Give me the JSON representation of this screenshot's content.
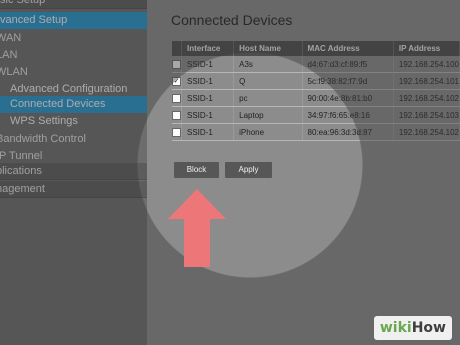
{
  "sidebar": {
    "items": [
      {
        "label": "sic Setup",
        "style": "sec"
      },
      {
        "label": "vanced Setup",
        "style": "active"
      },
      {
        "label": "WAN",
        "style": "plain"
      },
      {
        "label": "LAN",
        "style": "plain"
      },
      {
        "label": "WLAN",
        "style": "plain"
      },
      {
        "label": "Advanced Configuration",
        "style": "sub"
      },
      {
        "label": "Connected Devices",
        "style": "sub-active"
      },
      {
        "label": "WPS Settings",
        "style": "sub"
      },
      {
        "label": "Bandwidth Control",
        "style": "plain"
      },
      {
        "label": "IP Tunnel",
        "style": "plain"
      },
      {
        "label": "plications",
        "style": "sec"
      },
      {
        "label": "nagement",
        "style": "sec"
      }
    ]
  },
  "main": {
    "title": "Connected Devices",
    "table": {
      "headers": [
        "Interface",
        "Host Name",
        "MAC Address",
        "IP Address"
      ],
      "rows": [
        {
          "checked": false,
          "interface": "SSID-1",
          "host": "A3s",
          "mac": "d4:67:d3:cf:89:f5",
          "ip": "192.168.254.100"
        },
        {
          "checked": true,
          "interface": "SSID-1",
          "host": "Q",
          "mac": "5c:f9:38:82:f7:9d",
          "ip": "192.168.254.101"
        },
        {
          "checked": false,
          "interface": "SSID-1",
          "host": "pc",
          "mac": "90:00:4e:8b:81:b0",
          "ip": "192.168.254.102"
        },
        {
          "checked": false,
          "interface": "SSID-1",
          "host": "Laptop",
          "mac": "34:97:f6:65:e8:16",
          "ip": "192.168.254.103"
        },
        {
          "checked": false,
          "interface": "SSID-1",
          "host": "iPhone",
          "mac": "80:ea:96:3d:3d:87",
          "ip": "192.168.254.102"
        }
      ]
    },
    "buttons": {
      "block": "Block",
      "apply": "Apply"
    }
  },
  "overlay": {
    "spotlight_color": "#ffffff",
    "arrow_color": "#ec7678",
    "arrow_icon": "up-arrow-icon"
  },
  "watermark": {
    "part1": "wiki",
    "part2": "How"
  },
  "colors": {
    "accent": "#1f97d4",
    "sidebar": "#6d6d6d",
    "header": "#4c4c4c"
  }
}
